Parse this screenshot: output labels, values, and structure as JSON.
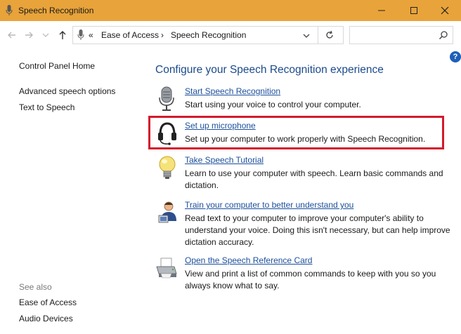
{
  "window": {
    "title": "Speech Recognition",
    "minimize_glyph": "—",
    "maximize_glyph": "☐",
    "close_glyph": "✕",
    "accent": "#e8a33a"
  },
  "nav": {
    "overflow": "«",
    "breadcrumb": [
      "Ease of Access",
      "Speech Recognition"
    ],
    "separator": "›"
  },
  "sidebar": {
    "home": "Control Panel Home",
    "links": [
      "Advanced speech options",
      "Text to Speech"
    ],
    "see_also_label": "See also",
    "see_also_links": [
      "Ease of Access",
      "Audio Devices"
    ]
  },
  "main": {
    "heading": "Configure your Speech Recognition experience",
    "tasks": [
      {
        "icon": "microphone-icon",
        "link": "Start Speech Recognition",
        "desc": "Start using your voice to control your computer."
      },
      {
        "icon": "headset-icon",
        "link": "Set up microphone",
        "desc": "Set up your computer to work properly with Speech Recognition."
      },
      {
        "icon": "lightbulb-icon",
        "link": "Take Speech Tutorial",
        "desc": "Learn to use your computer with speech.  Learn basic commands and dictation."
      },
      {
        "icon": "user-icon",
        "link": "Train your computer to better understand you",
        "desc": "Read text to your computer to improve your computer's ability to understand your voice.  Doing this isn't necessary, but can help improve dictation accuracy."
      },
      {
        "icon": "printer-icon",
        "link": "Open the Speech Reference Card",
        "desc": "View and print a list of common commands to keep with you so you always know what to say."
      }
    ]
  },
  "help": "?",
  "highlight_color": "#d31a2b"
}
